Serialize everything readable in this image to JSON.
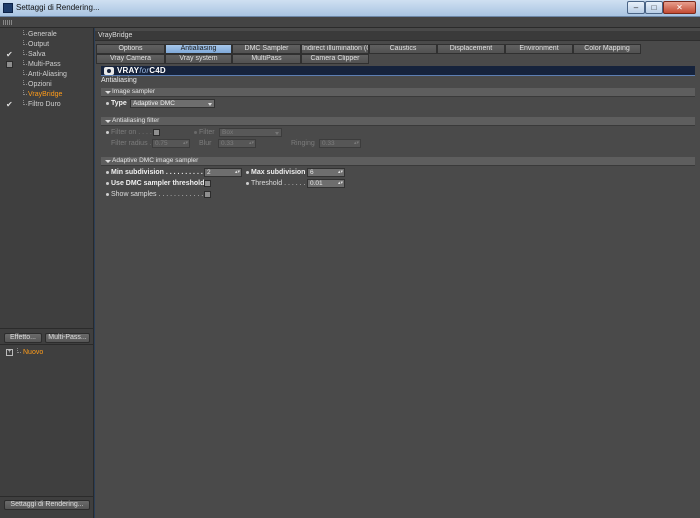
{
  "window": {
    "title": "Settaggi di Rendering..."
  },
  "left_panel": {
    "items": [
      {
        "label": "Generale",
        "check": "none",
        "active": false
      },
      {
        "label": "Output",
        "check": "none",
        "active": false
      },
      {
        "label": "Salva",
        "check": "checked",
        "active": false
      },
      {
        "label": "Multi-Pass",
        "check": "box",
        "active": false
      },
      {
        "label": "Anti-Aliasing",
        "check": "none",
        "active": false
      },
      {
        "label": "Opzioni",
        "check": "none",
        "active": false
      },
      {
        "label": "VrayBridge",
        "check": "none",
        "active": true
      },
      {
        "label": "Filtro Duro",
        "check": "checked",
        "active": false
      }
    ],
    "effect_button": "Effetto...",
    "multipass_button": "Multi-Pass...",
    "new_item": "Nuovo",
    "render_settings_button": "Settaggi di Rendering..."
  },
  "right_panel": {
    "header": "VrayBridge",
    "tabs_row1": [
      "Options",
      "Antialiasing",
      "DMC Sampler",
      "Indirect illumination (GI)",
      "Caustics",
      "Displacement",
      "Environment",
      "Color Mapping"
    ],
    "tabs_row2": [
      "Vray Camera",
      "Vray system",
      "MultiPass",
      "Camera Clipper"
    ],
    "active_tab": "Antialiasing",
    "logo": {
      "brand": "VRAY",
      "for": "for",
      "product": "C4D"
    },
    "section_title": "Antialiasing",
    "image_sampler": {
      "title": "Image sampler",
      "type_label": "Type",
      "type_value": "Adaptive DMC"
    },
    "aa_filter": {
      "title": "Antialiasing filter",
      "filter_on_label": "Filter on . . . .",
      "filter_label": "Filter",
      "filter_value": "Box",
      "radius_label": "Filter radius . .",
      "radius_value": "0.75",
      "blur_label": "Blur",
      "blur_value": "0.33",
      "ringing_label": "Ringing",
      "ringing_value": "0.33"
    },
    "dmc_sampler": {
      "title": "Adaptive DMC image sampler",
      "min_sub_label": "Min subdivision . . . . . . . . . .",
      "min_sub_value": "2",
      "max_sub_label": "Max subdivision",
      "max_sub_value": "6",
      "use_dmc_label": "Use DMC sampler threshold",
      "threshold_label": "Threshold . . . . . . .",
      "threshold_value": "0.01",
      "show_samples_label": "Show samples . . . . . . . . . . . . . ."
    }
  },
  "colors": {
    "active_tab": "#8fb5e0",
    "active_item": "#ff9c1a",
    "panel_bg": "#4a4a4a"
  }
}
